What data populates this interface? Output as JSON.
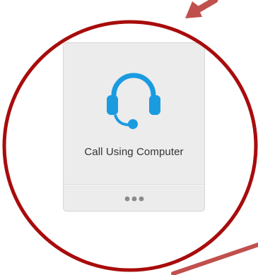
{
  "tile": {
    "label": "Call Using Computer",
    "icon": "headset-icon",
    "more_icon": "more-options-icon"
  },
  "colors": {
    "icon_blue": "#1a9be0",
    "annotation_red": "#a80c0c",
    "arrow_red": "#c0504d"
  }
}
